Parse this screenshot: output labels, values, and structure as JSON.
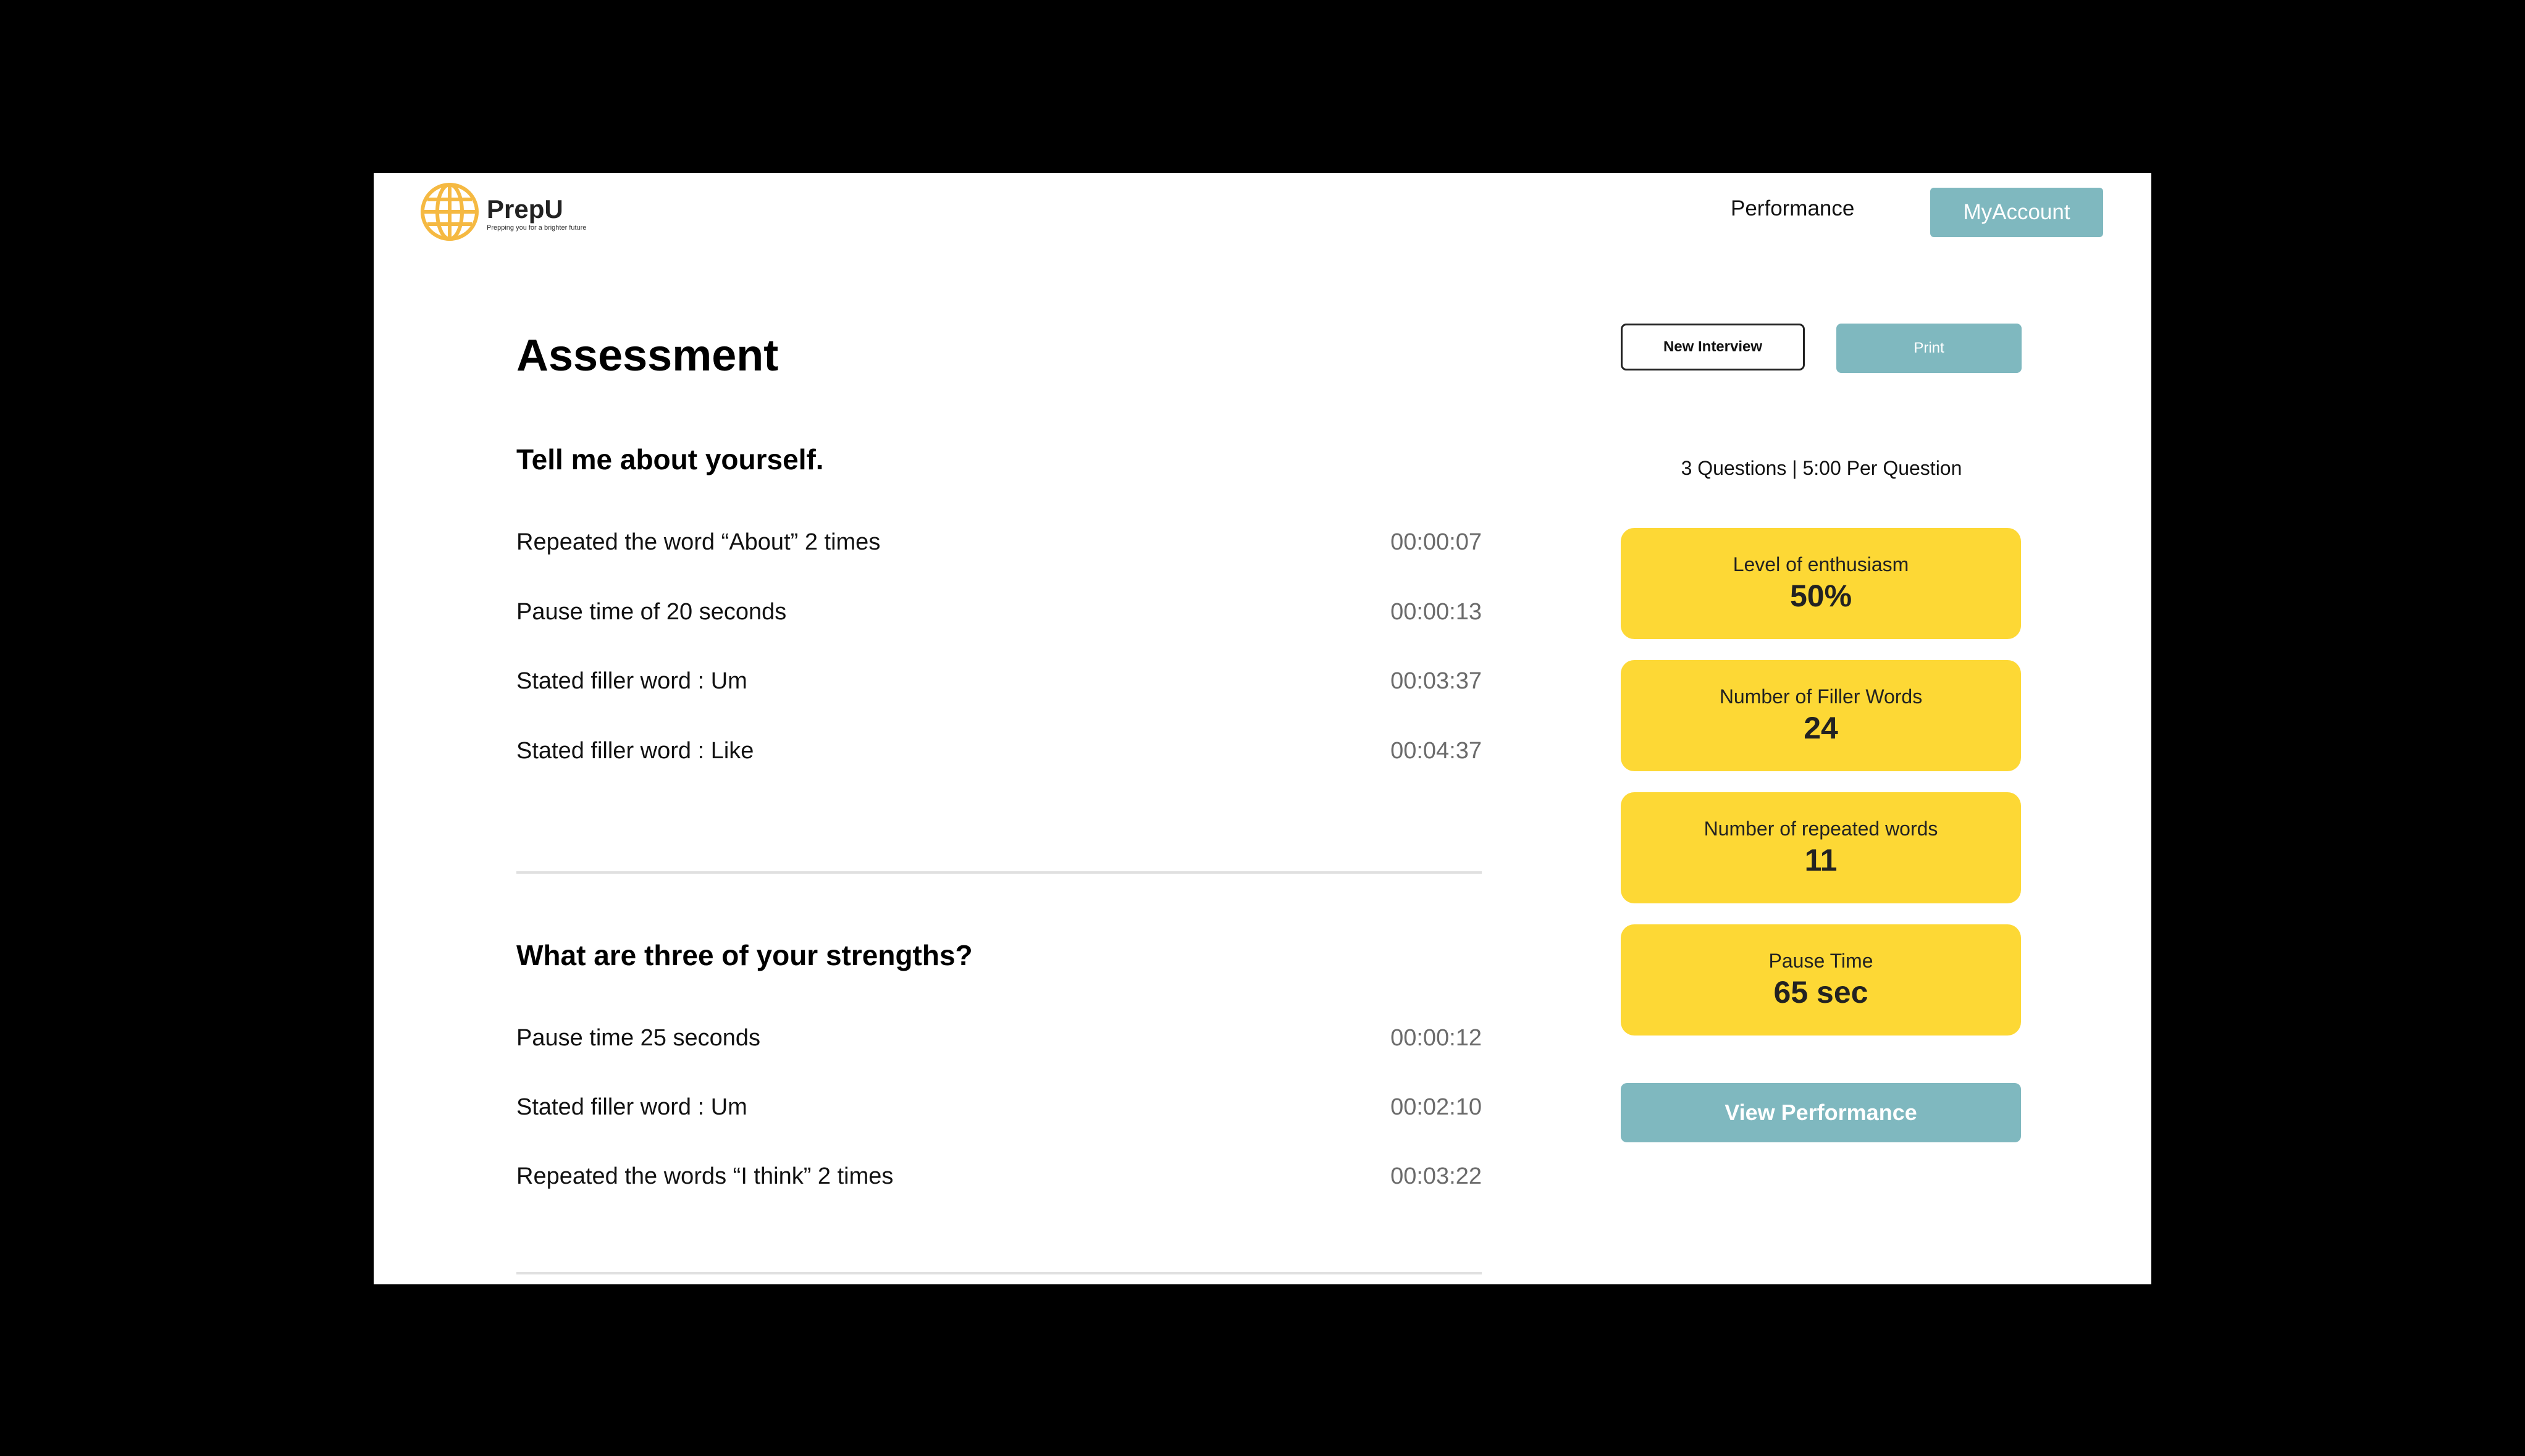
{
  "header": {
    "brand": "PrepU",
    "tagline": "Prepping you for a brighter future",
    "nav_performance": "Performance",
    "account_button": "MyAccount"
  },
  "main": {
    "title": "Assessment",
    "questions": [
      {
        "title": "Tell me about yourself.",
        "items": [
          {
            "text": "Repeated the word “About” 2 times",
            "time": "00:00:07"
          },
          {
            "text": "Pause time of 20 seconds",
            "time": "00:00:13"
          },
          {
            "text": "Stated filler word : Um",
            "time": "00:03:37"
          },
          {
            "text": "Stated filler word : Like",
            "time": "00:04:37"
          }
        ]
      },
      {
        "title": "What are three of your strengths?",
        "items": [
          {
            "text": "Pause time 25 seconds",
            "time": "00:00:12"
          },
          {
            "text": "Stated filler word : Um",
            "time": "00:02:10"
          },
          {
            "text": "Repeated the words “I think” 2 times",
            "time": "00:03:22"
          }
        ]
      }
    ]
  },
  "sidebar": {
    "new_interview": "New Interview",
    "print": "Print",
    "summary": "3 Questions | 5:00 Per Question",
    "stats": [
      {
        "label": "Level of enthusiasm",
        "value": "50%"
      },
      {
        "label": "Number of Filler Words",
        "value": "24"
      },
      {
        "label": "Number of repeated words",
        "value": "11"
      },
      {
        "label": "Pause Time",
        "value": "65 sec"
      }
    ],
    "view_performance": "View Performance"
  },
  "colors": {
    "accent_teal": "#7fb8bf",
    "stat_yellow": "#fdd835",
    "logo_orange": "#f5b942"
  },
  "icons": {
    "logo": "globe-icon"
  }
}
